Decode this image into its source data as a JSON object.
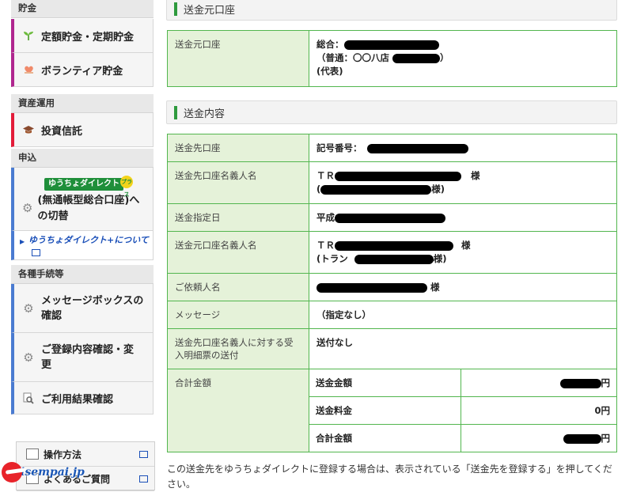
{
  "sidebar": {
    "savings": {
      "header": "貯金",
      "items": [
        {
          "label": "定額貯金・定期貯金",
          "icon": "sprout-icon"
        },
        {
          "label": "ボランティア貯金",
          "icon": "heart-hand-icon"
        }
      ]
    },
    "investment": {
      "header": "資産運用",
      "items": [
        {
          "label": "投資信託",
          "icon": "mortarboard-icon"
        }
      ]
    },
    "application": {
      "header": "申込",
      "badge": "ゆうちょダイレクト",
      "badge_plus": "プラス",
      "item_label": "(無通帳型総合口座)への切替",
      "sublink": "ゆうちょダイレクト+について"
    },
    "procedures": {
      "header": "各種手続等",
      "items": [
        {
          "label": "メッセージボックスの確認",
          "icon": "gear-icon"
        },
        {
          "label": "ご登録内容確認・変更",
          "icon": "gear-icon"
        },
        {
          "label": "ご利用結果確認",
          "icon": "magnifier-document-icon"
        }
      ]
    },
    "bottom": {
      "items": [
        {
          "label": "操作方法"
        },
        {
          "label": "よくあるご質問"
        }
      ]
    }
  },
  "watermark": "isempai.jp",
  "main": {
    "source_section": {
      "title": "送金元口座",
      "label": "送金元口座",
      "line1": "総合：",
      "line2_prefix": "（普通：〇〇八店",
      "line2_suffix": "）",
      "line3": "(代表)"
    },
    "details_section": {
      "title": "送金内容",
      "rows": {
        "dest_account": {
          "label": "送金先口座",
          "prefix": "記号番号："
        },
        "dest_name": {
          "label": "送金先口座名義人名",
          "prefix": "ＴＲ",
          "suffix": "様",
          "line2_prefix": "(",
          "line2_suffix": "様)"
        },
        "date": {
          "label": "送金指定日",
          "prefix": "平成"
        },
        "source_name": {
          "label": "送金元口座名義人名",
          "prefix": "ＴＲ",
          "suffix": "様",
          "line2_prefix": "(トラン",
          "line2_suffix": "様)"
        },
        "requester": {
          "label": "ご依頼人名",
          "suffix": "様"
        },
        "message": {
          "label": "メッセージ",
          "value": "（指定なし）"
        },
        "statement": {
          "label": "送金先口座名義人に対する受入明細票の送付",
          "value": "送付なし"
        },
        "total": {
          "label": "合計金額",
          "amount_label": "送金金額",
          "amount_suffix": "円",
          "fee_label": "送金料金",
          "fee_value": "0円",
          "sum_label": "合計金額",
          "sum_suffix": "円"
        }
      }
    },
    "note": "この送金先をゆうちょダイレクトに登録する場合は、表示されている「送金先を登録する」を押してください。"
  },
  "colors": {
    "accent_green": "#2e9a3e",
    "label_bg": "#e5f2d9",
    "border_green": "#52b64e"
  }
}
